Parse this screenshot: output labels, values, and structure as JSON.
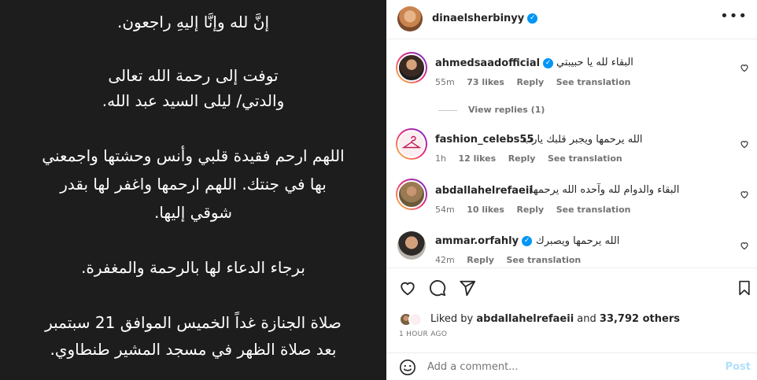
{
  "post_text": {
    "line1": "إنَّ لله وإنَّا إليهِ راجعون.",
    "line2": "توفت إلى رحمة الله تعالى",
    "line3": "والدتي/ ليلى السيد عبد الله.",
    "line4": "اللهم ارحم فقيدة قلبي وأنس وحشتها واجمعني",
    "line5": "بها في جنتك. اللهم ارحمها واغفر لها بقدر",
    "line6": "شوقي إليها.",
    "line7": "برجاء الدعاء لها بالرحمة والمغفرة.",
    "line8": "صلاة الجنازة غداً الخميس الموافق 21 سبتمبر",
    "line9": "بعد صلاة الظهر في مسجد المشير طنطاوي."
  },
  "header": {
    "username": "dinaelsherbinyy",
    "more_icon": "more-horizontal-icon"
  },
  "comments": [
    {
      "username": "ahmedsaadofficial",
      "verified": true,
      "text": "البقاء لله يا حبيبتي",
      "time": "55m",
      "likes": "73 likes",
      "reply": "Reply",
      "translate": "See translation",
      "view_replies": "View replies (1)"
    },
    {
      "username": "fashion_celebs55",
      "verified": false,
      "text": "الله يرحمها ويجبر قلبك يارب",
      "time": "1h",
      "likes": "12 likes",
      "reply": "Reply",
      "translate": "See translation"
    },
    {
      "username": "abdallahelrefaeii",
      "verified": false,
      "text": "البقاء والدوام لله وآحده الله يرحمها",
      "time": "54m",
      "likes": "10 likes",
      "reply": "Reply",
      "translate": "See translation"
    },
    {
      "username": "ammar.orfahly",
      "verified": true,
      "text": "الله يرحمها ويصبرك",
      "time": "42m",
      "reply": "Reply",
      "translate": "See translation"
    }
  ],
  "liked_by": {
    "prefix": "Liked by",
    "user": "abdallahelrefaeii",
    "and": "and",
    "others": "33,792 others"
  },
  "time_ago": "1 HOUR AGO",
  "add_comment": {
    "placeholder": "Add a comment...",
    "post_label": "Post"
  },
  "colors": {
    "post_bg": "#1d1d1d",
    "verified": "#0095f6",
    "post_button": "#b2dffc"
  }
}
